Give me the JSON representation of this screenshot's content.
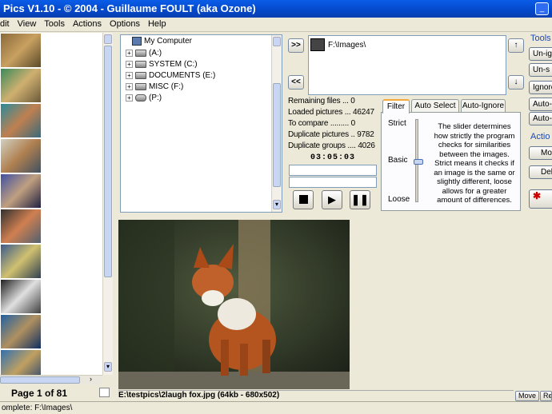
{
  "window": {
    "title": "Pics V1.10 - © 2004 - Guillaume FOULT (aka Ozone)"
  },
  "menu": [
    "dit",
    "View",
    "Tools",
    "Actions",
    "Options",
    "Help"
  ],
  "thumbnails": {
    "page_label": "Page 1 of 81"
  },
  "tree": {
    "root": "My Computer",
    "drives": [
      {
        "label": "(A:)",
        "icon": "floppy-icon"
      },
      {
        "label": "SYSTEM (C:)",
        "icon": "drive-icon"
      },
      {
        "label": "DOCUMENTS (E:)",
        "icon": "drive-icon"
      },
      {
        "label": "MISC (F:)",
        "icon": "drive-icon"
      },
      {
        "label": "(P:)",
        "icon": "cdrom-icon"
      }
    ]
  },
  "paths": {
    "add_label": ">>",
    "remove_label": "<<",
    "items": [
      "F:\\Images\\"
    ]
  },
  "stats": [
    "Remaining files ... 0",
    "Loaded pictures ... 46247",
    "To compare ......... 0",
    "Duplicate pictures .. 9782",
    "Duplicate groups .... 4026"
  ],
  "timer": "03:05:03",
  "tabs": [
    "Filter",
    "Auto Select",
    "Auto-Ignore"
  ],
  "filter": {
    "levels": [
      "Strict",
      "Basic",
      "Loose"
    ],
    "description": "The slider determines how strictly the program checks for similarities between the images. Strict means it checks if an image is the same or slightly different, loose allows for a greater amount of differences."
  },
  "tools": {
    "label": "Tools",
    "buttons": [
      "Un-ig",
      "Un-s",
      "Ignore",
      "Auto-",
      "Auto-"
    ]
  },
  "actions": {
    "label": "Actio",
    "buttons": [
      "Mo",
      "Del"
    ]
  },
  "preview": {
    "caption": "E:\\testpics\\2laugh fox.jpg (64kb - 680x502)",
    "move_label": "Move",
    "ren_label": "Ren"
  },
  "status": "omplete: F:\\Images\\"
}
